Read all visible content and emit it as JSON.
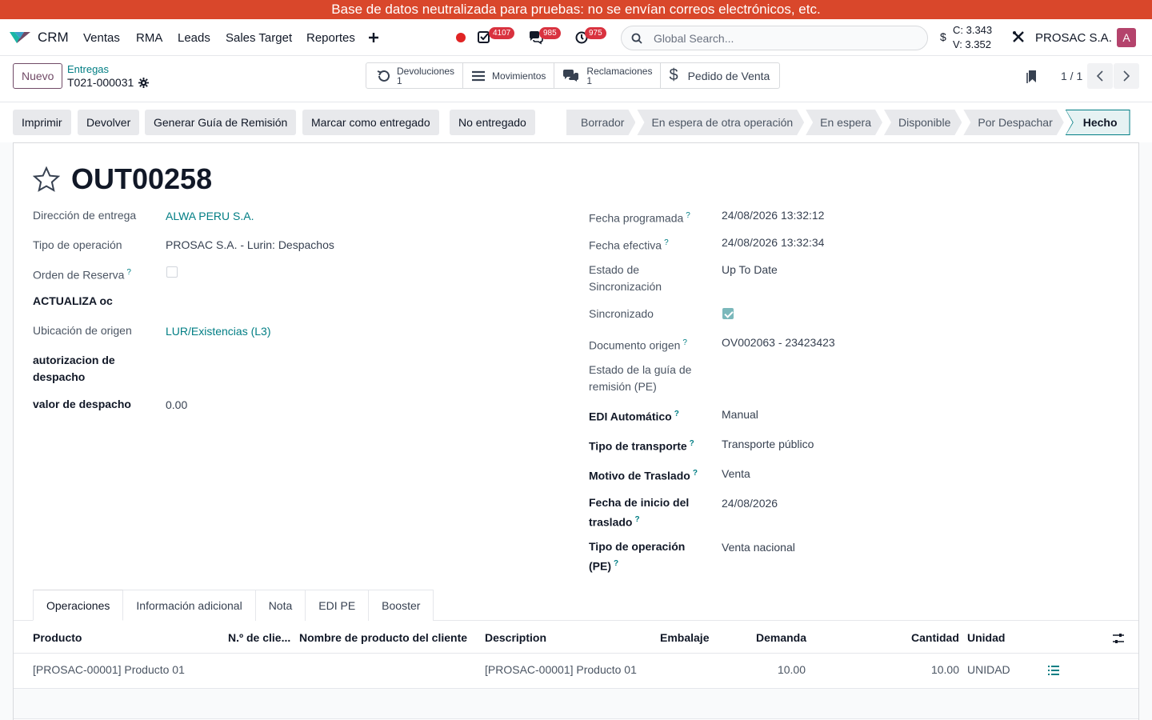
{
  "banner": "Base de datos neutralizada para pruebas: no se envían correos electrónicos, etc.",
  "navbar": {
    "app_name": "CRM",
    "menu": [
      "Ventas",
      "RMA",
      "Leads",
      "Sales Target",
      "Reportes"
    ],
    "badges": {
      "activities": "4107",
      "messages": "985",
      "timers": "975"
    },
    "search_placeholder": "Global Search...",
    "currency": {
      "symbol": "$",
      "c": "C: 3.343",
      "v": "V: 3.352"
    },
    "company": "PROSAC S.A.",
    "avatar_letter": "A"
  },
  "control_panel": {
    "new_label": "Nuevo",
    "breadcrumb_parent": "Entregas",
    "breadcrumb_current": "T021-000031",
    "smart_buttons": [
      {
        "label": "Devoluciones",
        "value": "1",
        "icon": "undo-icon"
      },
      {
        "label": "Movimientos",
        "value": "",
        "icon": "list-icon"
      },
      {
        "label": "Reclamaciones",
        "value": "1",
        "icon": "chat-icon"
      },
      {
        "label": "Pedido de Venta",
        "value": "",
        "icon": "dollar-icon"
      }
    ],
    "pager": "1 / 1"
  },
  "actions": [
    "Imprimir",
    "Devolver",
    "Generar Guía de Remisión",
    "Marcar como entregado",
    "No entregado"
  ],
  "statusbar": {
    "stages": [
      "Borrador",
      "En espera de otra operación",
      "En espera",
      "Disponible",
      "Por Despachar",
      "Hecho"
    ],
    "active": "Hecho"
  },
  "form": {
    "title": "OUT00258",
    "left": {
      "direccion_entrega": {
        "label": "Dirección de entrega",
        "value": "ALWA PERU S.A."
      },
      "tipo_operacion": {
        "label": "Tipo de operación",
        "value": "PROSAC S.A. - Lurin: Despachos"
      },
      "orden_reserva": {
        "label": "Orden de Reserva",
        "checked": false
      },
      "actualiza_oc": {
        "label": "ACTUALIZA oc"
      },
      "ubicacion_origen": {
        "label": "Ubicación de origen",
        "value": "LUR/Existencias (L3)"
      },
      "autorizacion": {
        "label_1": "autorizacion de",
        "label_2": "despacho"
      },
      "valor_despacho": {
        "label": "valor de despacho",
        "value": "0.00"
      }
    },
    "right": {
      "fecha_programada": {
        "label": "Fecha programada",
        "value": "24/08/2026 13:32:12"
      },
      "fecha_efectiva": {
        "label": "Fecha efectiva",
        "value": "24/08/2026 13:32:34"
      },
      "estado_sync": {
        "label_1": "Estado de",
        "label_2": "Sincronización",
        "value": "Up To Date"
      },
      "sincronizado": {
        "label": "Sincronizado",
        "checked": true
      },
      "documento_origen": {
        "label": "Documento origen",
        "value": "OV002063 - 23423423"
      },
      "estado_guia": {
        "label_1": "Estado de la guía de",
        "label_2": "remisión (PE)"
      },
      "edi_automatico": {
        "label": "EDI Automático",
        "value": "Manual"
      },
      "tipo_transporte": {
        "label": "Tipo de transporte",
        "value": "Transporte público"
      },
      "motivo_traslado": {
        "label": "Motivo de Traslado",
        "value": "Venta"
      },
      "fecha_inicio": {
        "label_1": "Fecha de inicio del",
        "label_2": "traslado",
        "value": "24/08/2026"
      },
      "tipo_operacion_pe": {
        "label_1": "Tipo de operación",
        "label_2": "(PE)",
        "value": "Venta nacional"
      }
    },
    "help_mark": "?"
  },
  "tabs": [
    "Operaciones",
    "Información adicional",
    "Nota",
    "EDI PE",
    "Booster"
  ],
  "table": {
    "headers": [
      "Producto",
      "N.º de clie...",
      "Nombre de producto del cliente",
      "Description",
      "Embalaje",
      "Demanda",
      "Cantidad",
      "Unidad"
    ],
    "rows": [
      {
        "producto": "[PROSAC-00001] Producto 01",
        "n_cliente": "",
        "nombre_cliente": "",
        "description": "[PROSAC-00001] Producto 01",
        "embalaje": "",
        "demanda": "10.00",
        "cantidad": "10.00",
        "unidad": "UNIDAD"
      }
    ]
  },
  "colors": {
    "brand": "#714b67",
    "accent": "#017e84",
    "banner": "#d9472b",
    "badge": "#d9323f"
  }
}
